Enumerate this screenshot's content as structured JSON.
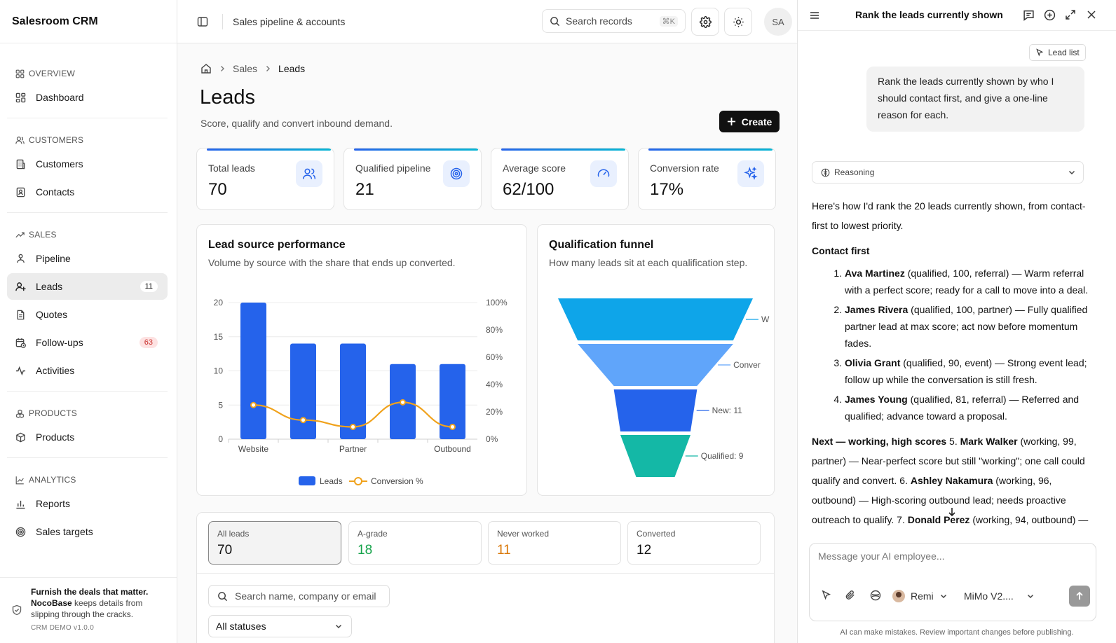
{
  "app": {
    "brand": "Salesroom CRM"
  },
  "sidebar": {
    "sections": [
      {
        "title": "OVERVIEW",
        "items": [
          {
            "label": "Dashboard"
          }
        ]
      },
      {
        "title": "CUSTOMERS",
        "items": [
          {
            "label": "Customers"
          },
          {
            "label": "Contacts"
          }
        ]
      },
      {
        "title": "SALES",
        "items": [
          {
            "label": "Pipeline"
          },
          {
            "label": "Leads",
            "badge": "11"
          },
          {
            "label": "Quotes"
          },
          {
            "label": "Follow-ups",
            "badge": "63"
          },
          {
            "label": "Activities"
          }
        ]
      },
      {
        "title": "PRODUCTS",
        "items": [
          {
            "label": "Products"
          }
        ]
      },
      {
        "title": "ANALYTICS",
        "items": [
          {
            "label": "Reports"
          },
          {
            "label": "Sales targets"
          }
        ]
      }
    ],
    "footer": {
      "line1": "Furnish the deals that matter.",
      "brand": "NocoBase",
      "line2": "keeps details from slipping through the cracks.",
      "version": "CRM DEMO v1.0.0"
    }
  },
  "header": {
    "title": "Sales pipeline & accounts",
    "search_label": "Search records",
    "search_kbd": "⌘K",
    "avatar": "SA"
  },
  "page": {
    "breadcrumb": [
      "Sales",
      "Leads"
    ],
    "title": "Leads",
    "subtitle": "Score, qualify and convert inbound demand.",
    "create_label": "Create"
  },
  "kpis": [
    {
      "label": "Total leads",
      "value": "70",
      "icon": "users-icon"
    },
    {
      "label": "Qualified pipeline",
      "value": "21",
      "icon": "target-icon"
    },
    {
      "label": "Average score",
      "value": "62/100",
      "icon": "gauge-icon"
    },
    {
      "label": "Conversion rate",
      "value": "17%",
      "icon": "sparkles-icon"
    }
  ],
  "charts": {
    "source": {
      "title": "Lead source performance",
      "subtitle": "Volume by source with the share that ends up converted."
    },
    "funnel": {
      "title": "Qualification funnel",
      "subtitle": "How many leads sit at each qualification step."
    }
  },
  "chart_data": [
    {
      "type": "bar",
      "categories": [
        "Website",
        "",
        "Partner",
        "",
        "Outbound"
      ],
      "series": [
        {
          "name": "Leads",
          "values": [
            20,
            14,
            14,
            11,
            11
          ],
          "color": "#2563eb",
          "axis": "left"
        },
        {
          "name": "Conversion %",
          "type": "line",
          "values": [
            25,
            14,
            9,
            27,
            9
          ],
          "color": "#f0a21c",
          "axis": "right"
        }
      ],
      "y_ticks": [
        "0",
        "5",
        "10",
        "15",
        "20"
      ],
      "y2_ticks": [
        "0%",
        "20%",
        "40%",
        "60%",
        "80%",
        "100%"
      ],
      "ylim": [
        0,
        20
      ],
      "y2lim": [
        0,
        100
      ],
      "grid": true,
      "legend": "bottom"
    },
    {
      "type": "funnel",
      "stages": [
        {
          "label": "W",
          "value": 28,
          "color": "#0ea5e9"
        },
        {
          "label": "Conver",
          "value": 22,
          "color": "#60a5fa"
        },
        {
          "label": "New: 11",
          "value": 11,
          "color": "#2563eb"
        },
        {
          "label": "Qualified: 9",
          "value": 9,
          "color": "#14b8a6"
        }
      ]
    }
  ],
  "table": {
    "stats": [
      {
        "label": "All leads",
        "value": "70",
        "color": "#111111"
      },
      {
        "label": "A-grade",
        "value": "18",
        "color": "#15a34a"
      },
      {
        "label": "Never worked",
        "value": "11",
        "color": "#d97706"
      },
      {
        "label": "Converted",
        "value": "12",
        "color": "#111111"
      }
    ],
    "search_placeholder": "Search name, company or email",
    "status_filter": "All statuses"
  },
  "chat": {
    "title": "Rank the leads currently shown",
    "context_chip": "Lead list",
    "user_message": "Rank the leads currently shown by who I should contact first, and give a one-line reason for each.",
    "reasoning_label": "Reasoning",
    "intro": "Here's how I'd rank the 20 leads currently shown, from contact-first to lowest priority.",
    "group1": "Contact first",
    "group1_items": [
      {
        "name": "Ava Martinez",
        "meta": " (qualified, 100, referral) — Warm referral with a perfect score; ready for a call to move into a deal."
      },
      {
        "name": "James Rivera",
        "meta": " (qualified, 100, partner) — Fully qualified partner lead at max score; act now before momentum fades."
      },
      {
        "name": "Olivia Grant",
        "meta": " (qualified, 90, event) — Strong event lead; follow up while the conversation is still fresh."
      },
      {
        "name": "James Young",
        "meta": " (qualified, 81, referral) — Referred and qualified; advance toward a proposal."
      }
    ],
    "group2": "Next — working, high scores",
    "group2_items": [
      {
        "prefix": " 5. ",
        "name": "Mark Walker",
        "meta": " (working, 99, partner) — Near-perfect score but still \"working\"; one call could qualify and convert."
      },
      {
        "prefix": " 6. ",
        "name": "Ashley Nakamura",
        "meta": " (working, 96, outbound) — High-scoring outbound lead; needs proactive outreach to qualify."
      },
      {
        "prefix": " 7. ",
        "name": "Donald Perez",
        "meta": " (working, 94, outbound) —"
      }
    ],
    "composer_placeholder": "Message your AI employee...",
    "agent_name": "Remi",
    "model_name": "MiMo V2....",
    "disclaimer": "AI can make mistakes. Review important changes before publishing."
  }
}
